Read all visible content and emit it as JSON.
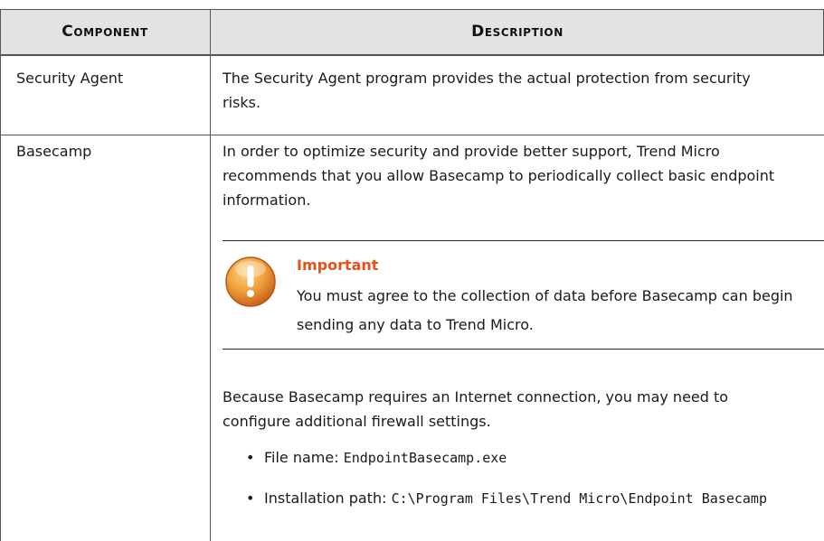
{
  "headers": {
    "component": "Component",
    "description": "Description"
  },
  "rows": [
    {
      "component": "Security Agent",
      "description": "The Security Agent program provides the actual protection from security risks."
    },
    {
      "component": "Basecamp",
      "intro": "In order to optimize security and provide better support, Trend Micro recommends that you allow Basecamp to periodically collect basic endpoint information.",
      "important": {
        "icon": "warning-icon",
        "title": "Important",
        "text": "You must agree to the collection of data before Basecamp can begin sending any data to Trend Micro."
      },
      "outro": "Because Basecamp requires an Internet connection, you may need to configure additional firewall settings.",
      "bullets": [
        {
          "label": "File name: ",
          "value": "EndpointBasecamp.exe"
        },
        {
          "label": "Installation path: ",
          "value": "C:\\Program Files\\Trend Micro\\Endpoint Basecamp"
        }
      ]
    }
  ],
  "colors": {
    "header_bg": "#e3e3e3",
    "important_accent": "#e8501a",
    "icon_fill": "#f0a13a"
  }
}
